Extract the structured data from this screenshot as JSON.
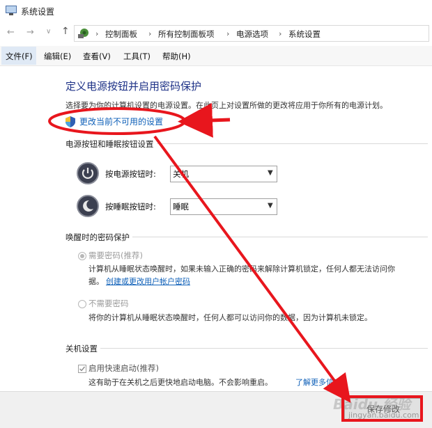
{
  "window": {
    "title": "系统设置"
  },
  "address_bar": {
    "breadcrumbs": [
      "控制面板",
      "所有控制面板项",
      "电源选项",
      "系统设置"
    ],
    "separator": "›"
  },
  "nav": {
    "back": "←",
    "forward": "→",
    "recent": "∨",
    "up": "↑"
  },
  "menu": {
    "items": [
      "文件(F)",
      "编辑(E)",
      "查看(V)",
      "工具(T)",
      "帮助(H)"
    ]
  },
  "page": {
    "title": "定义电源按钮并启用密码保护",
    "description": "选择要为你的计算机设置的电源设置。在此页上对设置所做的更改将应用于你所有的电源计划。",
    "change_link": "更改当前不可用的设置"
  },
  "power_buttons_section": {
    "title": "电源按钮和睡眠按钮设置",
    "power_button": {
      "label": "按电源按钮时:",
      "value": "关机"
    },
    "sleep_button": {
      "label": "按睡眠按钮时:",
      "value": "睡眠"
    }
  },
  "wake_password_section": {
    "title": "唤醒时的密码保护",
    "require_option": {
      "label": "需要密码(推荐)",
      "desc_line1": "计算机从睡眠状态唤醒时，如果未输入正确的密码来解除计算机锁定，任何人都无法访问你",
      "desc_line2": "据。",
      "link": "创建或更改用户帐户密码",
      "selected": true
    },
    "no_require_option": {
      "label": "不需要密码",
      "desc": "将你的计算机从睡眠状态唤醒时，任何人都可以访问你的数据，因为计算机未锁定。",
      "selected": false
    }
  },
  "shutdown_section": {
    "title": "关机设置",
    "fast_startup": {
      "label": "启用快速启动(推荐)",
      "desc": "这有助于在关机之后更快地启动电脑。不会影响重启。",
      "link": "了解更多信息",
      "checked": true
    }
  },
  "footer": {
    "save_button": "保存修改"
  },
  "watermark": {
    "text": "jingyan.baidu.com",
    "logo": "Baidu 经验"
  },
  "colors": {
    "annotation": "#e8161d",
    "link": "#0d5fb8",
    "title": "#1e3287"
  }
}
